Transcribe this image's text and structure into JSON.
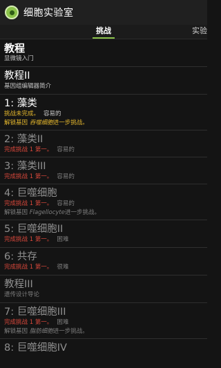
{
  "app": {
    "title": "细胞实验室"
  },
  "tabs": {
    "challenge": "挑战",
    "experiment": "实验"
  },
  "items": [
    {
      "title": "教程",
      "subtitle": "显微镜入门"
    },
    {
      "title": "教程II",
      "subtitle": "基因组编辑器简介"
    },
    {
      "title": "1: 藻类",
      "status": "挑战未完成。",
      "difficulty": "容易的",
      "unlock_prefix": "解锁基因",
      "unlock_gene": "吞噬细胞",
      "unlock_suffix": "进一步挑战。"
    },
    {
      "title": "2: 藻类II",
      "status": "完成挑战 1 第一。",
      "difficulty": "容易的"
    },
    {
      "title": "3: 藻类III",
      "status": "完成挑战 1 第一。",
      "difficulty": "容易的"
    },
    {
      "title": "4: 巨噬细胞",
      "status": "完成挑战 1 第一。",
      "difficulty": "容易的",
      "unlock_prefix": "解锁基因",
      "unlock_gene": "Flagellocyte",
      "unlock_suffix": "进一步挑战。"
    },
    {
      "title": "5: 巨噬细胞II",
      "status": "完成挑战 1 第一。",
      "difficulty": "困难"
    },
    {
      "title": "6: 共存",
      "status": "完成挑战 1 第一。",
      "difficulty": "很难"
    },
    {
      "title": "教程III",
      "subtitle": "遗传设计导论"
    },
    {
      "title": "7: 巨噬细胞III",
      "status": "完成挑战 1 第一。",
      "difficulty": "困难",
      "unlock_prefix": "解锁基因",
      "unlock_gene": "脂肪细胞",
      "unlock_suffix": "进一步挑战。"
    },
    {
      "title": "8: 巨噬细胞IV"
    }
  ]
}
